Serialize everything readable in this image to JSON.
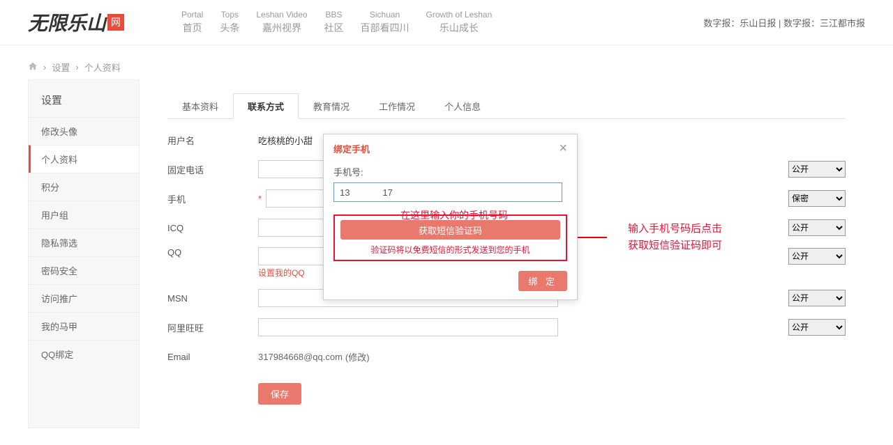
{
  "header": {
    "logo_text": "无限乐山",
    "logo_badge": "网",
    "nav": [
      {
        "en": "Portal",
        "cn": "首页"
      },
      {
        "en": "Tops",
        "cn": "头条"
      },
      {
        "en": "Leshan Video",
        "cn": "嘉州视界"
      },
      {
        "en": "BBS",
        "cn": "社区"
      },
      {
        "en": "Sichuan",
        "cn": "百部看四川"
      },
      {
        "en": "Growth of Leshan",
        "cn": "乐山成长"
      }
    ],
    "right_links": "数字报：乐山日报 | 数字报：三江都市报"
  },
  "breadcrumb": {
    "item1": "设置",
    "item2": "个人资料"
  },
  "sidebar": {
    "title": "设置",
    "items": [
      "修改头像",
      "个人资料",
      "积分",
      "用户组",
      "隐私筛选",
      "密码安全",
      "访问推广",
      "我的马甲",
      "QQ绑定"
    ],
    "active_index": 1
  },
  "tabs": {
    "items": [
      "基本资料",
      "联系方式",
      "教育情况",
      "工作情况",
      "个人信息"
    ],
    "active_index": 1
  },
  "form": {
    "username": {
      "label": "用户名",
      "value": "吃核桃的小甜"
    },
    "landline": {
      "label": "固定电话",
      "value": "",
      "visibility": "公开"
    },
    "mobile": {
      "label": "手机",
      "required": true,
      "value": "",
      "visibility": "保密"
    },
    "icq": {
      "label": "ICQ",
      "value": "",
      "visibility": "公开"
    },
    "qq": {
      "label": "QQ",
      "value": "",
      "visibility": "公开",
      "link": "设置我的QQ"
    },
    "msn": {
      "label": "MSN",
      "value": "",
      "visibility": "公开"
    },
    "aliww": {
      "label": "阿里旺旺",
      "value": "",
      "visibility": "公开"
    },
    "email": {
      "label": "Email",
      "value": "317984668@qq.com",
      "action": "(修改)"
    },
    "save_label": "保存"
  },
  "modal": {
    "title": "绑定手机",
    "phone_label": "手机号:",
    "phone_value": "13             17",
    "hint_inline": "在这里输入你的手机号码",
    "sms_button": "获取短信验证码",
    "sms_note": "验证码将以免费短信的形式发送到您的手机",
    "bind_label": "绑 定"
  },
  "annotation": {
    "line1": "输入手机号码后点击",
    "line2": "获取短信验证码即可"
  },
  "visibility_options": [
    "公开",
    "保密"
  ]
}
